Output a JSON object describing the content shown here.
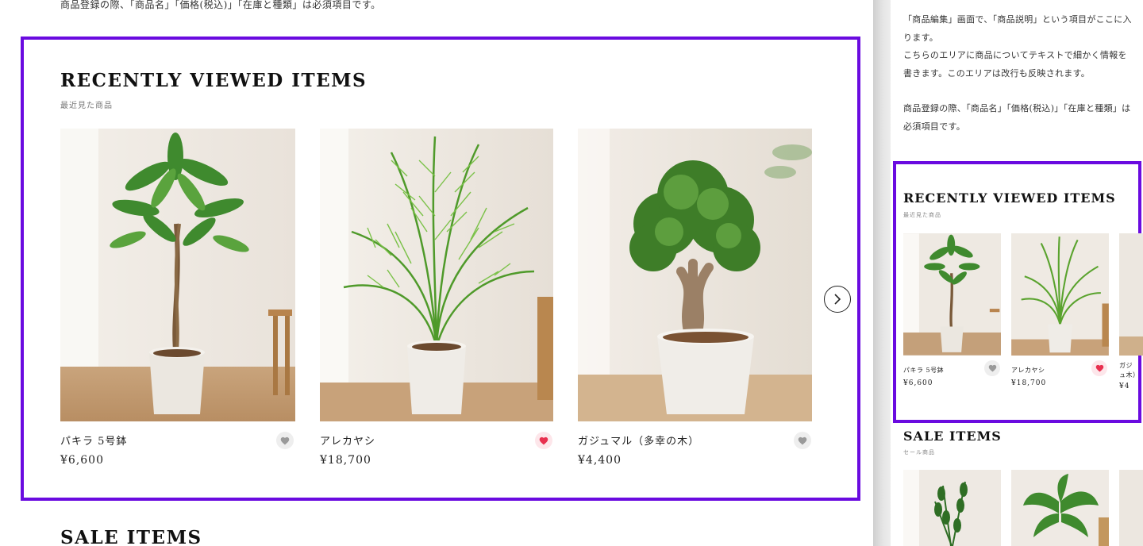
{
  "desktop": {
    "top_note": "商品登録の際、「商品名」「価格(税込)」「在庫と種類」は必須項目です。",
    "recent": {
      "title": "RECENTLY VIEWED ITEMS",
      "subtitle": "最近見た商品",
      "items": [
        {
          "name": "パキラ 5号鉢",
          "price": "¥6,600",
          "favorited": false,
          "plant": "pachira"
        },
        {
          "name": "アレカヤシ",
          "price": "¥18,700",
          "favorited": true,
          "plant": "areca-palm"
        },
        {
          "name": "ガジュマル（多幸の木）",
          "price": "¥4,400",
          "favorited": false,
          "plant": "gajumaru"
        }
      ]
    },
    "sale_title": "SALE ITEMS"
  },
  "mobile": {
    "description": [
      "「商品編集」画面で、「商品説明」という項目がここに入ります。",
      "こちらのエリアに商品についてテキストで細かく情報を書きます。このエリアは改行も反映されます。",
      "",
      "商品登録の際、「商品名」「価格(税込)」「在庫と種類」は必須項目です。"
    ],
    "recent": {
      "title": "RECENTLY VIEWED ITEMS",
      "subtitle": "最近見た商品",
      "items": [
        {
          "name": "パキラ 5号鉢",
          "price": "¥6,600",
          "favorited": false,
          "plant": "pachira"
        },
        {
          "name": "アレカヤシ",
          "price": "¥18,700",
          "favorited": true,
          "plant": "areca-palm"
        },
        {
          "name": "ガジュ木）",
          "price": "¥4",
          "favorited": false,
          "plant": "gajumaru",
          "partial": true
        }
      ]
    },
    "sale": {
      "title": "SALE ITEMS",
      "subtitle": "セール商品",
      "items": [
        {
          "plant": "zz-plant"
        },
        {
          "plant": "philodendron"
        }
      ]
    }
  },
  "colors": {
    "highlight": "#6a0be0",
    "heart_active": "#e8304f",
    "heart_inactive": "#9a9a9a",
    "fav_active_bg": "#fde6ea",
    "fav_inactive_bg": "#eeeeee"
  },
  "icons": {
    "favorite": "heart-icon",
    "next": "chevron-right-icon"
  }
}
